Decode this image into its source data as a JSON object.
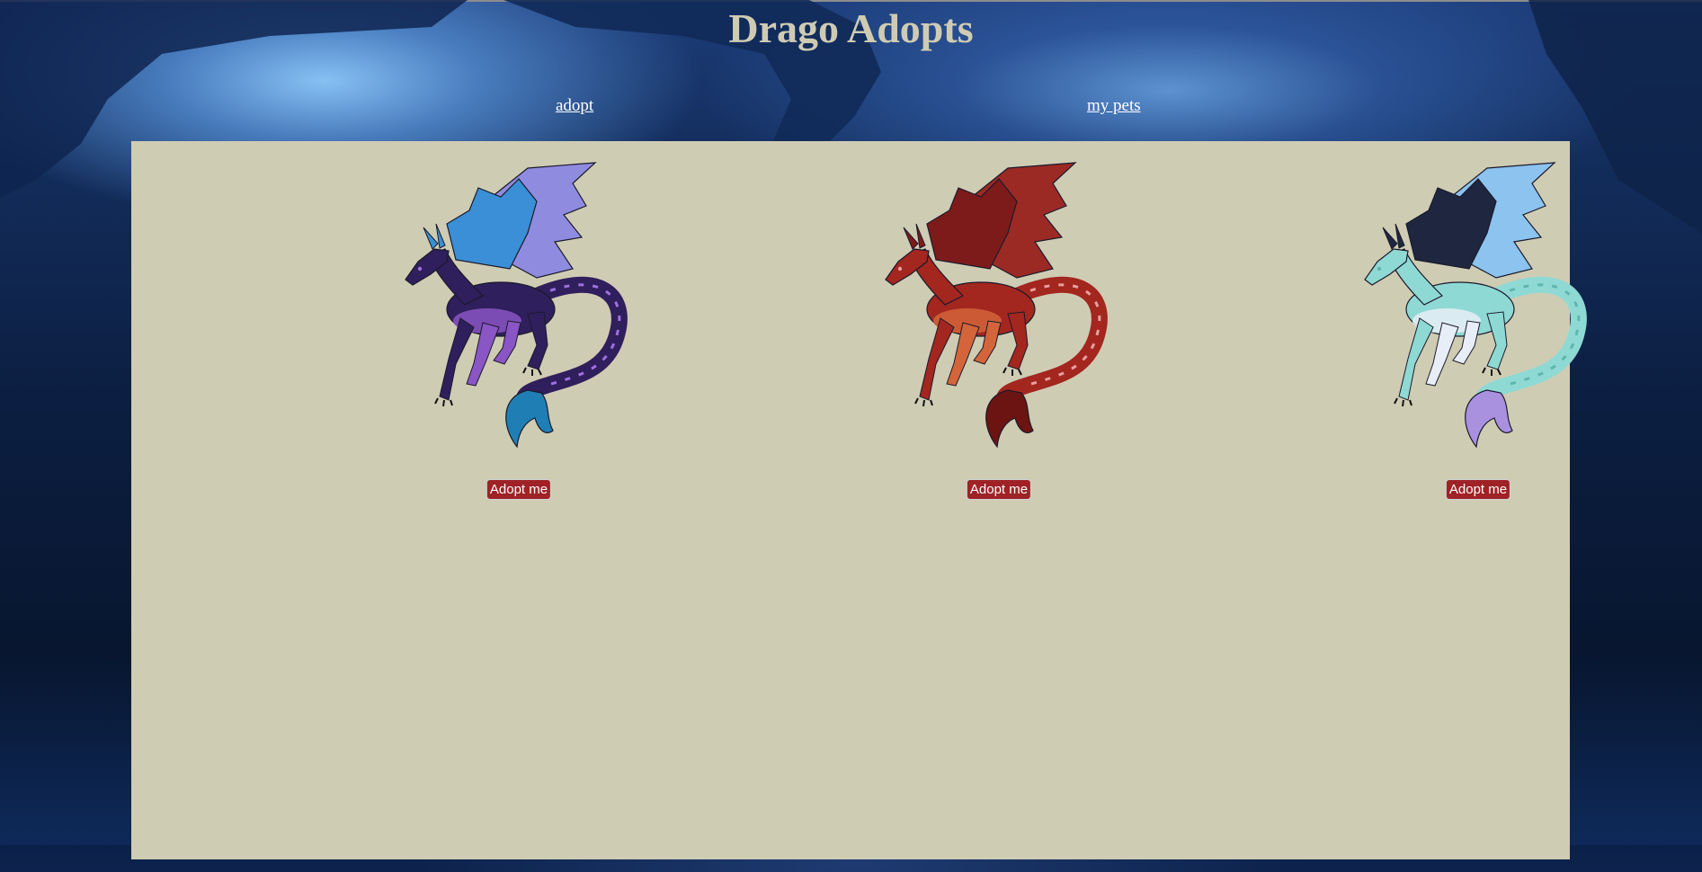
{
  "header": {
    "title": "Drago Adopts"
  },
  "nav": {
    "adopt_label": "adopt",
    "my_pets_label": "my pets"
  },
  "pets": [
    {
      "adopt_label": "Adopt me",
      "colors": {
        "body": "#2f1f5c",
        "belly": "#8a55c4",
        "wing": "#3a8fd6",
        "wing_edge": "#8f8ce0",
        "tail_tip": "#1f7fb5",
        "accent": "#a070e0"
      }
    },
    {
      "adopt_label": "Adopt me",
      "colors": {
        "body": "#a3261f",
        "belly": "#d4653a",
        "wing": "#7d1b1b",
        "wing_edge": "#9c2a24",
        "tail_tip": "#6b1412",
        "accent": "#e8a0a0"
      }
    },
    {
      "adopt_label": "Adopt me",
      "colors": {
        "body": "#8fd9d4",
        "belly": "#e8eef7",
        "wing": "#1f2740",
        "wing_edge": "#8cc3ef",
        "tail_tip": "#a991e0",
        "accent": "#5fb6ad"
      }
    }
  ]
}
